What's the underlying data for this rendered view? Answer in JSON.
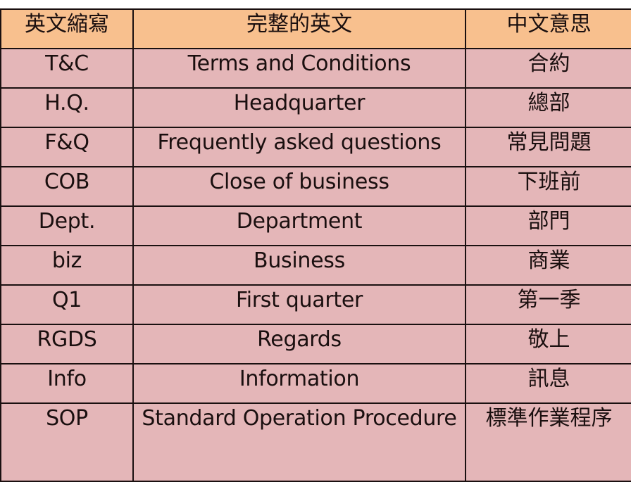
{
  "table": {
    "headers": [
      "英文縮寫",
      "完整的英文",
      "中文意思"
    ],
    "rows": [
      {
        "abbr": "T&C",
        "full": "Terms and Conditions",
        "zh": "合約"
      },
      {
        "abbr": "H.Q.",
        "full": "Headquarter",
        "zh": "總部"
      },
      {
        "abbr": "F&Q",
        "full": "Frequently asked questions",
        "zh": "常見問題"
      },
      {
        "abbr": "COB",
        "full": "Close of business",
        "zh": "下班前"
      },
      {
        "abbr": "Dept.",
        "full": "Department",
        "zh": "部門"
      },
      {
        "abbr": "biz",
        "full": "Business",
        "zh": "商業"
      },
      {
        "abbr": "Q1",
        "full": "First quarter",
        "zh": "第一季"
      },
      {
        "abbr": "RGDS",
        "full": "Regards",
        "zh": "敬上"
      },
      {
        "abbr": "Info",
        "full": "Information",
        "zh": "訊息"
      },
      {
        "abbr": "SOP",
        "full": "Standard Operation Procedure",
        "zh": "標準作業程序"
      }
    ]
  },
  "colors": {
    "header_bg": "#f8c08e",
    "row_bg": "#e4b6b8",
    "border": "#1a1010"
  }
}
